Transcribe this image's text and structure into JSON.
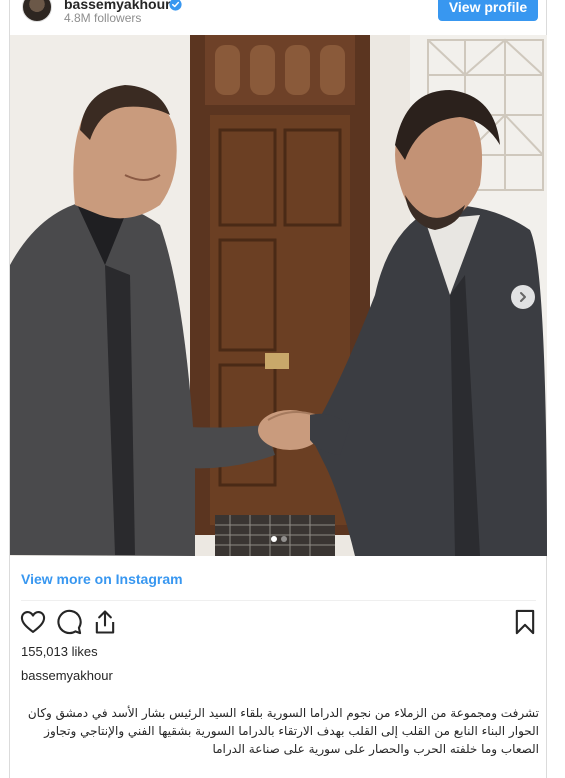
{
  "header": {
    "username": "bassemyakhour",
    "followers": "4.8M followers",
    "view_profile_label": "View profile"
  },
  "media": {
    "carousel_total": 2,
    "carousel_active": 1,
    "scene": "two men in dark suits shaking hands in front of a carved wooden door"
  },
  "footer": {
    "view_more_label": "View more on Instagram",
    "likes": "155,013 likes",
    "author": "bassemyakhour",
    "caption": "تشرفت ومجموعة من الزملاء من نجوم الدراما السورية بلقاء السيد الرئيس بشار الأسد في دمشق وكان الحوار البناء النابع من القلب إلى القلب بهدف الارتقاء بالدراما السورية بشقيها الفني والإنتاجي وتجاوز الصعاب وما خلفته الحرب والحصار على سورية على صناعة الدراما"
  },
  "icons": {
    "verified": "verified-badge-icon",
    "like": "heart-icon",
    "comment": "comment-icon",
    "share": "share-icon",
    "save": "bookmark-icon",
    "next": "chevron-right-icon"
  },
  "colors": {
    "accent": "#3897f0",
    "text": "#262626",
    "muted": "#8e8e8e",
    "border": "#dbdbdb"
  }
}
